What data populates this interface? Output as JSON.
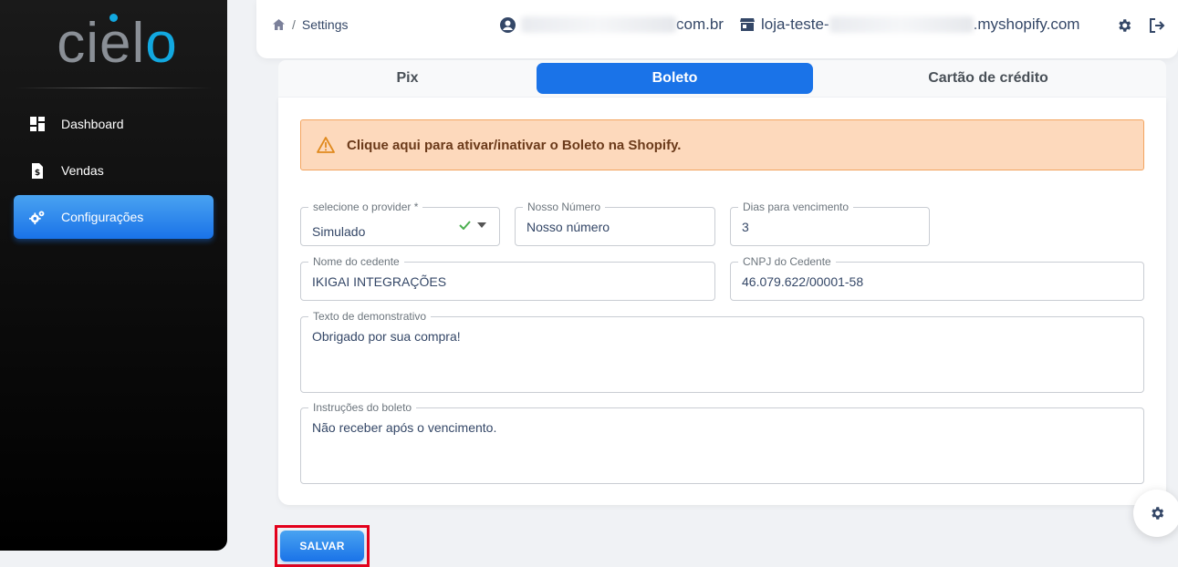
{
  "brand": {
    "name": "cielo",
    "accent_color": "#12a8e0"
  },
  "sidebar": {
    "items": [
      {
        "label": "Dashboard",
        "icon": "dashboard-icon",
        "active": false
      },
      {
        "label": "Vendas",
        "icon": "receipt-icon",
        "active": false
      },
      {
        "label": "Configurações",
        "icon": "gears-icon",
        "active": true
      }
    ]
  },
  "header": {
    "breadcrumb_page": "Settings",
    "account_email_suffix": "com.br",
    "store_prefix": "loja-teste-",
    "store_suffix": ".myshopify.com"
  },
  "tabs": [
    {
      "label": "Pix",
      "active": false
    },
    {
      "label": "Boleto",
      "active": true
    },
    {
      "label": "Cartão de crédito",
      "active": false
    }
  ],
  "alert": {
    "text": "Clique aqui para ativar/inativar o Boleto na Shopify."
  },
  "form": {
    "provider": {
      "label": "selecione o provider *",
      "value": "Simulado"
    },
    "nosso_numero": {
      "label": "Nosso Número",
      "placeholder": "Nosso número"
    },
    "dias_vencimento": {
      "label": "Dias para vencimento",
      "value": "3"
    },
    "nome_cedente": {
      "label": "Nome do cedente",
      "value": "IKIGAI INTEGRAÇÕES"
    },
    "cnpj_cedente": {
      "label": "CNPJ do Cedente",
      "value": "46.079.622/00001-58"
    },
    "texto_demonstrativo": {
      "label": "Texto de demonstrativo",
      "value": "Obrigado por sua compra!"
    },
    "instrucoes_boleto": {
      "label": "Instruções do boleto",
      "value": "Não receber após o vencimento."
    }
  },
  "actions": {
    "save_label": "SALVAR"
  },
  "colors": {
    "primary": "#1a73e8",
    "alert_bg": "#fdd9bc",
    "alert_border": "#f3a45f",
    "highlight": "#e3001b"
  }
}
